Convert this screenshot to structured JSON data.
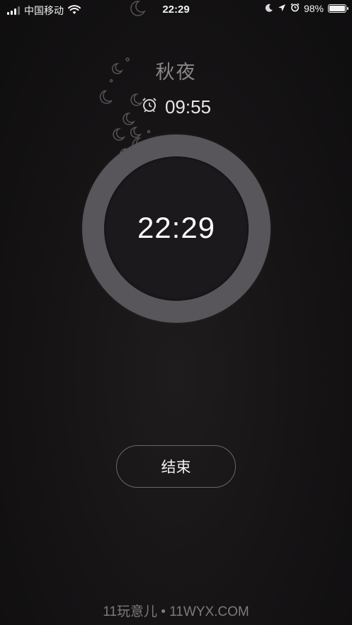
{
  "status_bar": {
    "carrier": "中国移动",
    "time": "22:29",
    "battery_percent": "98%",
    "battery_level": 0.98,
    "icons": [
      "signal-icon",
      "wifi-icon",
      "moon-icon",
      "location-icon",
      "alarm-icon",
      "battery-icon"
    ]
  },
  "alarm": {
    "title": "秋夜",
    "alarm_time": "09:55",
    "current_time": "22:29",
    "end_label": "结束"
  },
  "watermark": "11玩意儿 • 11WYX.COM",
  "colors": {
    "ring": "#58565a",
    "background": "#151314",
    "title": "#8a8789"
  }
}
